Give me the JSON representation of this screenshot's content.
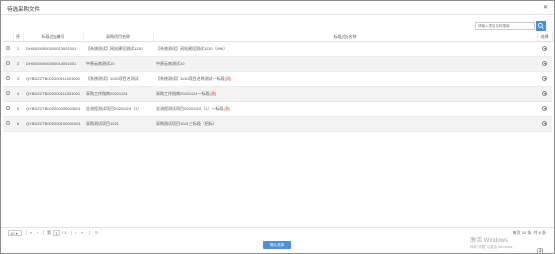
{
  "dialog": {
    "title": "待选采购文件",
    "close_symbol": "✕"
  },
  "search": {
    "placeholder": "请输入项目名称搜索",
    "icon": "search-icon"
  },
  "table": {
    "headers": [
      "",
      "序",
      "标段(包)编号",
      "采购项目名称",
      "标段(包)名称",
      "选择"
    ],
    "rows": [
      {
        "no": "1",
        "code": "DH00000000000013001001",
        "project": "【系统测试】网站建设测试1130",
        "name": "【系统测试】网站建设测试1130（099）",
        "flag": ""
      },
      {
        "no": "2",
        "code": "DH00000000000014001001",
        "project": "中原云南测试10",
        "name": "中原云南测试10",
        "flag": ""
      },
      {
        "no": "3",
        "code": "QYBDZZTB002000111003002",
        "project": "【系统测试】1130项目名测试",
        "name": "【系统测试】1130项目名称测试一标段",
        "flag": "(测)"
      },
      {
        "no": "4",
        "code": "QYBDZZTB002000111001001",
        "project": "采购工作指南20201124",
        "name": "采购工作指南20201124一标段",
        "flag": "(测)"
      },
      {
        "no": "5",
        "code": "QYBDZZTB002000099003001",
        "project": "全流程测试项目20201119（1）",
        "name": "全流程测试项目20201119（1）一标段",
        "flag": "(测)"
      },
      {
        "no": "6",
        "code": "QYBDZZTB002000100001001",
        "project": "采购测试项目1021",
        "name": "采购测试项目1021三标段（招标）",
        "flag": ""
      }
    ]
  },
  "pager": {
    "page_size": "10 ▾",
    "first": "«",
    "prev": "‹",
    "page_label": "第",
    "page_value": "1",
    "total_pages": "/ 1",
    "next": "›",
    "last": "»",
    "refresh": "↻",
    "summary": "每页 10 条, 共 6 条"
  },
  "confirm_label": "确认选择",
  "watermark": {
    "line1": "激活 Windows",
    "line2": "转到\"设置\"以激活 Windows。"
  },
  "corner_label": "(3)"
}
